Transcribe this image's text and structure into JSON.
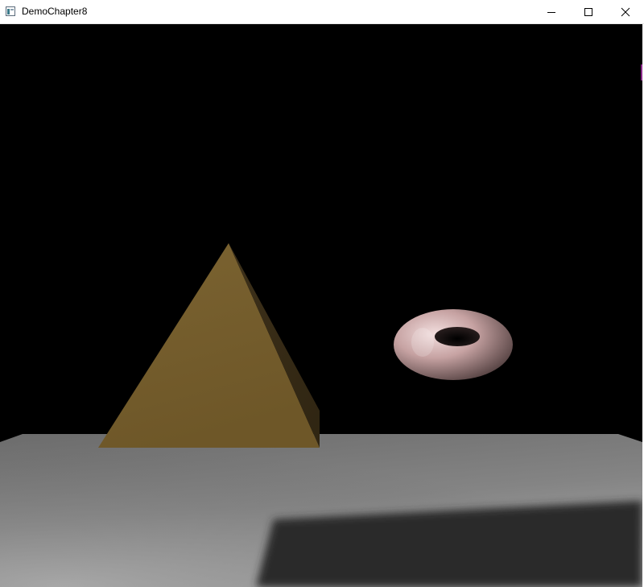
{
  "window": {
    "title": "DemoChapter8",
    "controls": {
      "minimize_icon": "minimize-icon",
      "maximize_icon": "maximize-icon",
      "close_icon": "close-icon"
    }
  },
  "scene": {
    "background_color": "#000000",
    "floor_color": "#7a7a7a",
    "shadow_color": "#2a2a2a",
    "pyramid_color": "#7a6232",
    "torus_color": "#c9a8a8"
  }
}
